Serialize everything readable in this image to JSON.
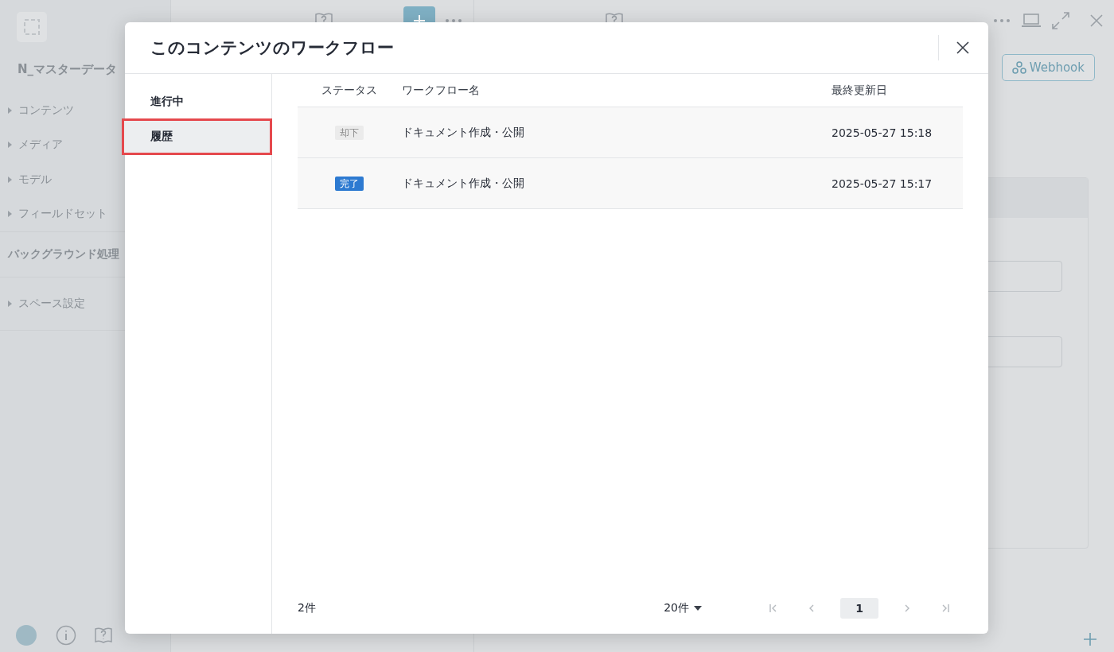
{
  "sidebar": {
    "space_name": "N_マスターデータ",
    "items": [
      {
        "label": "コンテンツ",
        "kind": "group",
        "expanded": false
      },
      {
        "label": "メディア",
        "kind": "group",
        "expanded": false
      },
      {
        "label": "モデル",
        "kind": "group",
        "expanded": false
      },
      {
        "label": "フィールドセット",
        "kind": "group",
        "expanded": false
      },
      {
        "label": "バックグラウンド処理",
        "kind": "link"
      },
      {
        "label": "スペース設定",
        "kind": "group",
        "expanded": false
      }
    ]
  },
  "content_panel": {
    "webhook_button": "Webhook"
  },
  "modal": {
    "title": "このコンテンツのワークフロー",
    "tabs": [
      {
        "label": "進行中",
        "selected": false
      },
      {
        "label": "履歴",
        "selected": true
      }
    ],
    "table": {
      "columns": [
        "ステータス",
        "ワークフロー名",
        "最終更新日"
      ],
      "rows": [
        {
          "status": {
            "label": "却下",
            "kind": "rejected"
          },
          "name": "ドキュメント作成・公開",
          "updated": "2025-05-27 15:18"
        },
        {
          "status": {
            "label": "完了",
            "kind": "done"
          },
          "name": "ドキュメント作成・公開",
          "updated": "2025-05-27 15:17"
        }
      ]
    },
    "footer": {
      "count": "2件",
      "page_size": "20件",
      "pages": [
        {
          "label": "1",
          "selected": true
        }
      ]
    }
  }
}
